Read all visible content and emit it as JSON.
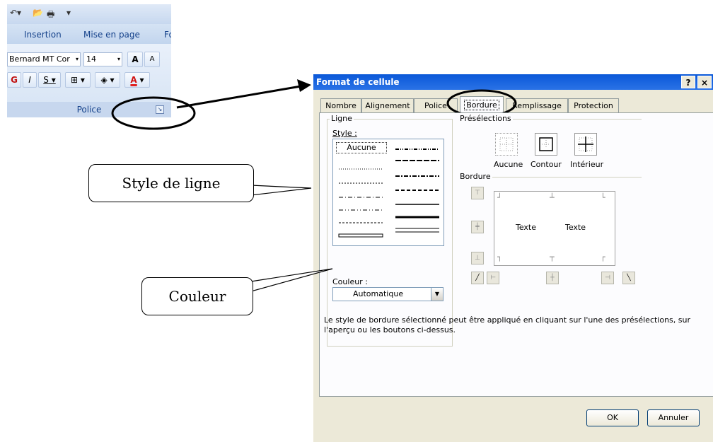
{
  "ribbon": {
    "tabs": [
      "Insertion",
      "Mise en page",
      "Fo"
    ],
    "font_name": "Bernard MT Cor",
    "font_size": "14",
    "bold_label": "G",
    "italic_label": "I",
    "underline_label": "S",
    "grow_font_label": "A",
    "shrink_font_label": "A",
    "group_label": "Police",
    "font_color": "#e02020"
  },
  "dialog": {
    "title": "Format de cellule",
    "help_label": "?",
    "close_label": "×",
    "tabs": [
      "Nombre",
      "Alignement",
      "Police",
      "Bordure",
      "Remplissage",
      "Protection"
    ],
    "active_tab": "Bordure",
    "line_group": "Ligne",
    "style_label": "Style :",
    "style_none": "Aucune",
    "color_label": "Couleur :",
    "color_value": "Automatique",
    "presets_group": "Présélections",
    "preset_none": "Aucune",
    "preset_outline": "Contour",
    "preset_inside": "Intérieur",
    "border_group": "Bordure",
    "preview_text_left": "Texte",
    "preview_text_right": "Texte",
    "help_text": "Le style de bordure sélectionné peut être appliqué en cliquant sur l'une des présélections, sur l'aperçu ou les boutons ci-dessus.",
    "ok_label": "OK",
    "cancel_label": "Annuler"
  },
  "callouts": {
    "style": "Style de ligne",
    "color": "Couleur"
  },
  "colors": {
    "title_bar": "#0a58d8",
    "dialog_bg": "#ece9d8",
    "ribbon_bg": "#c9d9ee"
  }
}
